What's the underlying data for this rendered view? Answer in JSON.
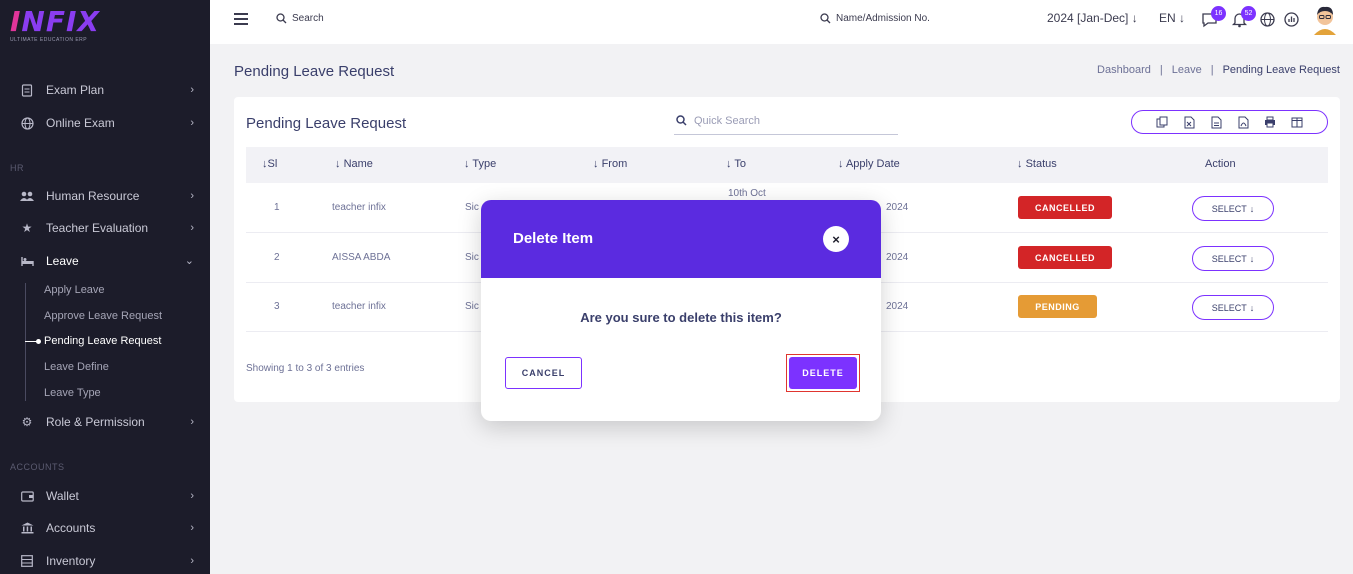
{
  "brand": {
    "logo": "INFIX",
    "tagline": "ULTIMATE EDUCATION ERP"
  },
  "sidebar": {
    "items_top": [
      {
        "label": "Exam Plan",
        "icon": "exam-plan-icon"
      },
      {
        "label": "Online Exam",
        "icon": "globe-icon"
      }
    ],
    "section_hr": "HR",
    "items_hr": [
      {
        "label": "Human Resource",
        "icon": "users-icon"
      },
      {
        "label": "Teacher Evaluation",
        "icon": "star-icon"
      },
      {
        "label": "Leave",
        "icon": "bed-icon"
      }
    ],
    "leave_sub": [
      {
        "label": "Apply Leave"
      },
      {
        "label": "Approve Leave Request"
      },
      {
        "label": "Pending Leave Request"
      },
      {
        "label": "Leave Define"
      },
      {
        "label": "Leave Type"
      }
    ],
    "items_after": [
      {
        "label": "Role & Permission",
        "icon": "gear-icon"
      }
    ],
    "section_accounts": "ACCOUNTS",
    "items_accounts": [
      {
        "label": "Wallet",
        "icon": "wallet-icon"
      },
      {
        "label": "Accounts",
        "icon": "bank-icon"
      },
      {
        "label": "Inventory",
        "icon": "inventory-icon"
      }
    ]
  },
  "topbar": {
    "search_label": "Search",
    "name_search_label": "Name/Admission No.",
    "year": "2024 [Jan-Dec]",
    "language": "EN",
    "chat_badge": "16",
    "notification_badge": "52"
  },
  "page": {
    "title": "Pending Leave Request",
    "breadcrumb": [
      "Dashboard",
      "|",
      "Leave",
      "|",
      "Pending Leave Request"
    ]
  },
  "card": {
    "title": "Pending Leave Request",
    "quick_search_placeholder": "Quick Search",
    "columns": [
      "Sl",
      "Name",
      "Type",
      "From",
      "To",
      "Apply Date",
      "Status",
      "Action"
    ],
    "rows": [
      {
        "sl": "1",
        "name": "teacher infix",
        "type": "Sic",
        "to": "10th Oct",
        "apply": "2024",
        "status": "CANCELLED",
        "status_kind": "cancelled",
        "action": "SELECT"
      },
      {
        "sl": "2",
        "name": "AISSA ABDA",
        "type": "Sic",
        "to": "",
        "apply": "2024",
        "status": "CANCELLED",
        "status_kind": "cancelled",
        "action": "SELECT"
      },
      {
        "sl": "3",
        "name": "teacher infix",
        "type": "Sic",
        "to": "",
        "apply": "2024",
        "status": "PENDING",
        "status_kind": "pending",
        "action": "SELECT"
      }
    ],
    "showing": "Showing 1 to 3 of 3 entries"
  },
  "modal": {
    "title": "Delete Item",
    "close": "×",
    "message": "Are you sure to delete this item?",
    "cancel_label": "CANCEL",
    "delete_label": "DELETE"
  },
  "colors": {
    "accent": "#7c32ff",
    "header": "#5b2be0",
    "cancelled": "#d32527",
    "pending": "#e59b35",
    "sidebar": "#1c1c2a"
  }
}
